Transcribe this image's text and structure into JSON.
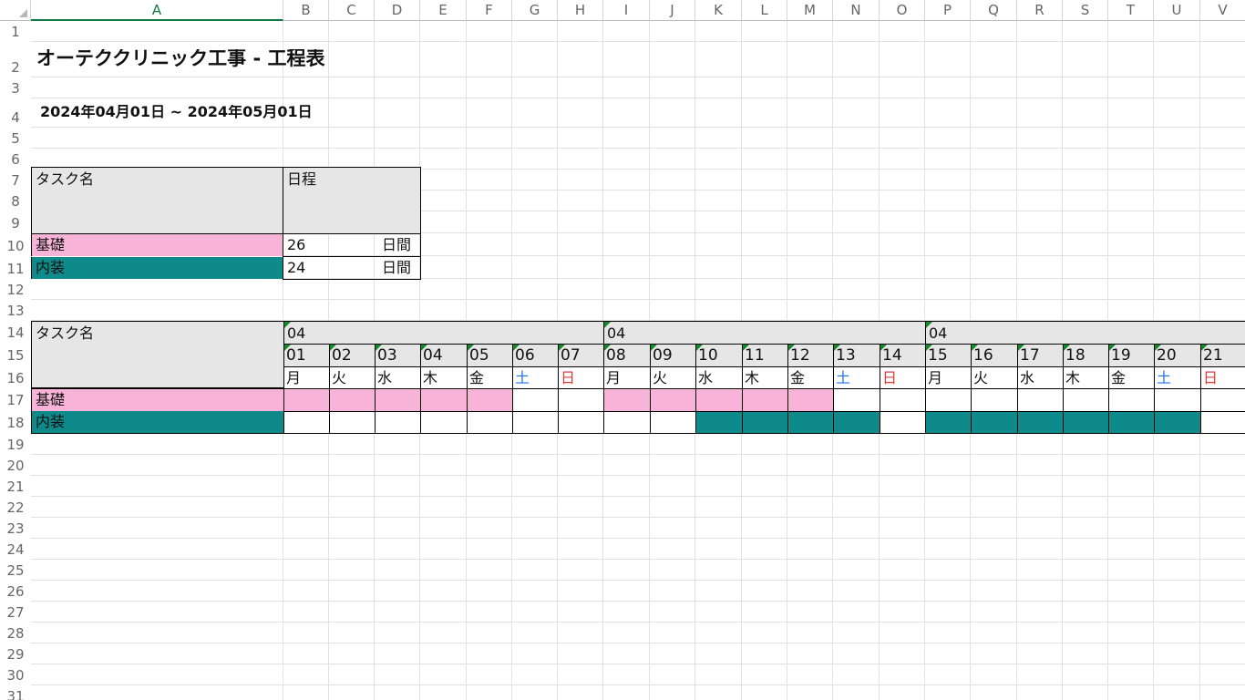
{
  "columns": [
    "A",
    "B",
    "C",
    "D",
    "E",
    "F",
    "G",
    "H",
    "I",
    "J",
    "K",
    "L",
    "M",
    "N",
    "O",
    "P",
    "Q",
    "R",
    "S",
    "T",
    "U",
    "V"
  ],
  "selected_column": "A",
  "rows": [
    "1",
    "2",
    "3",
    "4",
    "5",
    "6",
    "7",
    "8",
    "9",
    "10",
    "11",
    "12",
    "13",
    "14",
    "15",
    "16",
    "17",
    "18",
    "19",
    "20",
    "21",
    "22",
    "23",
    "24",
    "25",
    "26",
    "27",
    "28",
    "29",
    "30",
    "31"
  ],
  "title": "オーテククリニック工事 - 工程表",
  "date_range": "2024年04月01日 ~ 2024年05月01日",
  "summary": {
    "task_header": "タスク名",
    "schedule_header": "日程",
    "tasks": [
      {
        "name": "基礎",
        "days": "26",
        "unit": "日間",
        "color": "#f8b4d8"
      },
      {
        "name": "内装",
        "days": "24",
        "unit": "日間",
        "color": "#0f8a8a"
      }
    ]
  },
  "gantt": {
    "task_header": "タスク名",
    "month_labels": [
      "04",
      "04",
      "04"
    ],
    "days": [
      "01",
      "02",
      "03",
      "04",
      "05",
      "06",
      "07",
      "08",
      "09",
      "10",
      "11",
      "12",
      "13",
      "14",
      "15",
      "16",
      "17",
      "18",
      "19",
      "20",
      "21"
    ],
    "weekdays": [
      "月",
      "火",
      "水",
      "木",
      "金",
      "土",
      "日",
      "月",
      "火",
      "水",
      "木",
      "金",
      "土",
      "日",
      "月",
      "火",
      "水",
      "木",
      "金",
      "土",
      "日"
    ],
    "rows": [
      {
        "name": "基礎",
        "color": "#f8b4d8",
        "filled": [
          1,
          1,
          1,
          1,
          1,
          0,
          0,
          1,
          1,
          1,
          1,
          1,
          0,
          0,
          0,
          0,
          0,
          0,
          0,
          0,
          0
        ]
      },
      {
        "name": "内装",
        "color": "#0f8a8a",
        "filled": [
          0,
          0,
          0,
          0,
          0,
          0,
          0,
          0,
          0,
          1,
          1,
          1,
          1,
          0,
          1,
          1,
          1,
          1,
          1,
          1,
          0
        ]
      }
    ],
    "colors": {
      "saturday": "#1a73e8",
      "sunday": "#e53935",
      "header_fill": "#e6e6e6"
    }
  }
}
